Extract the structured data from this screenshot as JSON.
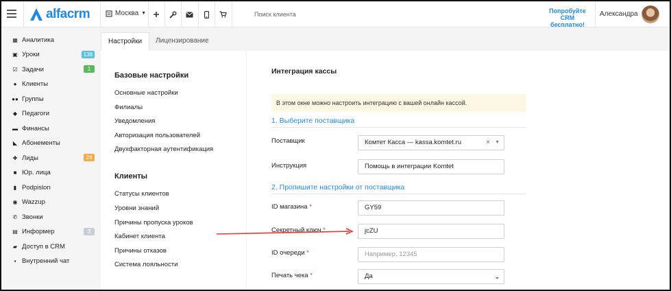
{
  "brand": {
    "name": "alfacrm",
    "accent": "#1e88e5"
  },
  "topbar": {
    "city": "Москва",
    "icons": [
      "menu-icon",
      "plus-icon",
      "wrench-icon",
      "mail-icon",
      "phone-icon",
      "cart-icon"
    ],
    "search_placeholder": "Поиск клиента",
    "try_line1": "Попробуйте",
    "try_line2": "CRM бесплатно!",
    "user": "Александра"
  },
  "sidebar": {
    "items": [
      {
        "label": "Аналитика",
        "icon": "analytics-icon"
      },
      {
        "label": "Уроки",
        "icon": "calendar-icon",
        "badge": "138",
        "badge_color": "#5bc0de"
      },
      {
        "label": "Задачи",
        "icon": "tasks-icon",
        "badge": "1",
        "badge_color": "#5cb85c"
      },
      {
        "label": "Клиенты",
        "icon": "user-icon"
      },
      {
        "label": "Группы",
        "icon": "users-icon"
      },
      {
        "label": "Педагоги",
        "icon": "graduation-cap-icon"
      },
      {
        "label": "Финансы",
        "icon": "money-icon"
      },
      {
        "label": "Абонементы",
        "icon": "tag-icon"
      },
      {
        "label": "Лиды",
        "icon": "user-plus-icon",
        "badge": "24",
        "badge_color": "#f0ad4e"
      },
      {
        "label": "Юр. лица",
        "icon": "briefcase-icon"
      },
      {
        "label": "Podpislon",
        "icon": "document-icon"
      },
      {
        "label": "Wazzup",
        "icon": "whatsapp-icon"
      },
      {
        "label": "Звонки",
        "icon": "phone-icon"
      },
      {
        "label": "Информер",
        "icon": "informer-icon",
        "badge": "3",
        "badge_color": "#c9ced6"
      },
      {
        "label": "Доступ в CRM",
        "icon": "lock-icon"
      },
      {
        "label": "Внутренний чат",
        "icon": "chat-icon"
      }
    ]
  },
  "tabs": [
    {
      "label": "Настройки",
      "active": true
    },
    {
      "label": "Лицензирование",
      "active": false
    }
  ],
  "settings_menu": {
    "basic_heading": "Базовые настройки",
    "basic_links": [
      "Основные настройки",
      "Филиалы",
      "Уведомления",
      "Авторизация пользователей",
      "Двухфакторная аутентификация"
    ],
    "clients_heading": "Клиенты",
    "clients_links": [
      "Статусы клиентов",
      "Уровни знаний",
      "Причины пропуска уроков",
      "Кабинет клиента",
      "Причины отказов",
      "Система лояльности"
    ]
  },
  "content": {
    "title": "Интеграция кассы",
    "info": "В этом окне можно настроить интеграцию с вашей онлайн кассой.",
    "section1": "1. Выберите поставщика",
    "section2": "2. Пропишите настройки от поставщика",
    "supplier_label": "Поставщик",
    "supplier_value": "Комтет Касса — kassa.komtet.ru",
    "instruction_label": "Инструкция",
    "instruction_value": "Помощь в интеграции Komtet",
    "shop_id_label": "ID магазина",
    "shop_id_value": "GY59",
    "secret_label": "Секретный ключ",
    "secret_value": "jcZU",
    "queue_label": "ID очереди",
    "queue_placeholder": "Например, 12345",
    "print_label": "Печать чека",
    "print_value": "Да",
    "required_mark": "*",
    "clear_mark": "×",
    "dropdown_mark": "▼"
  }
}
